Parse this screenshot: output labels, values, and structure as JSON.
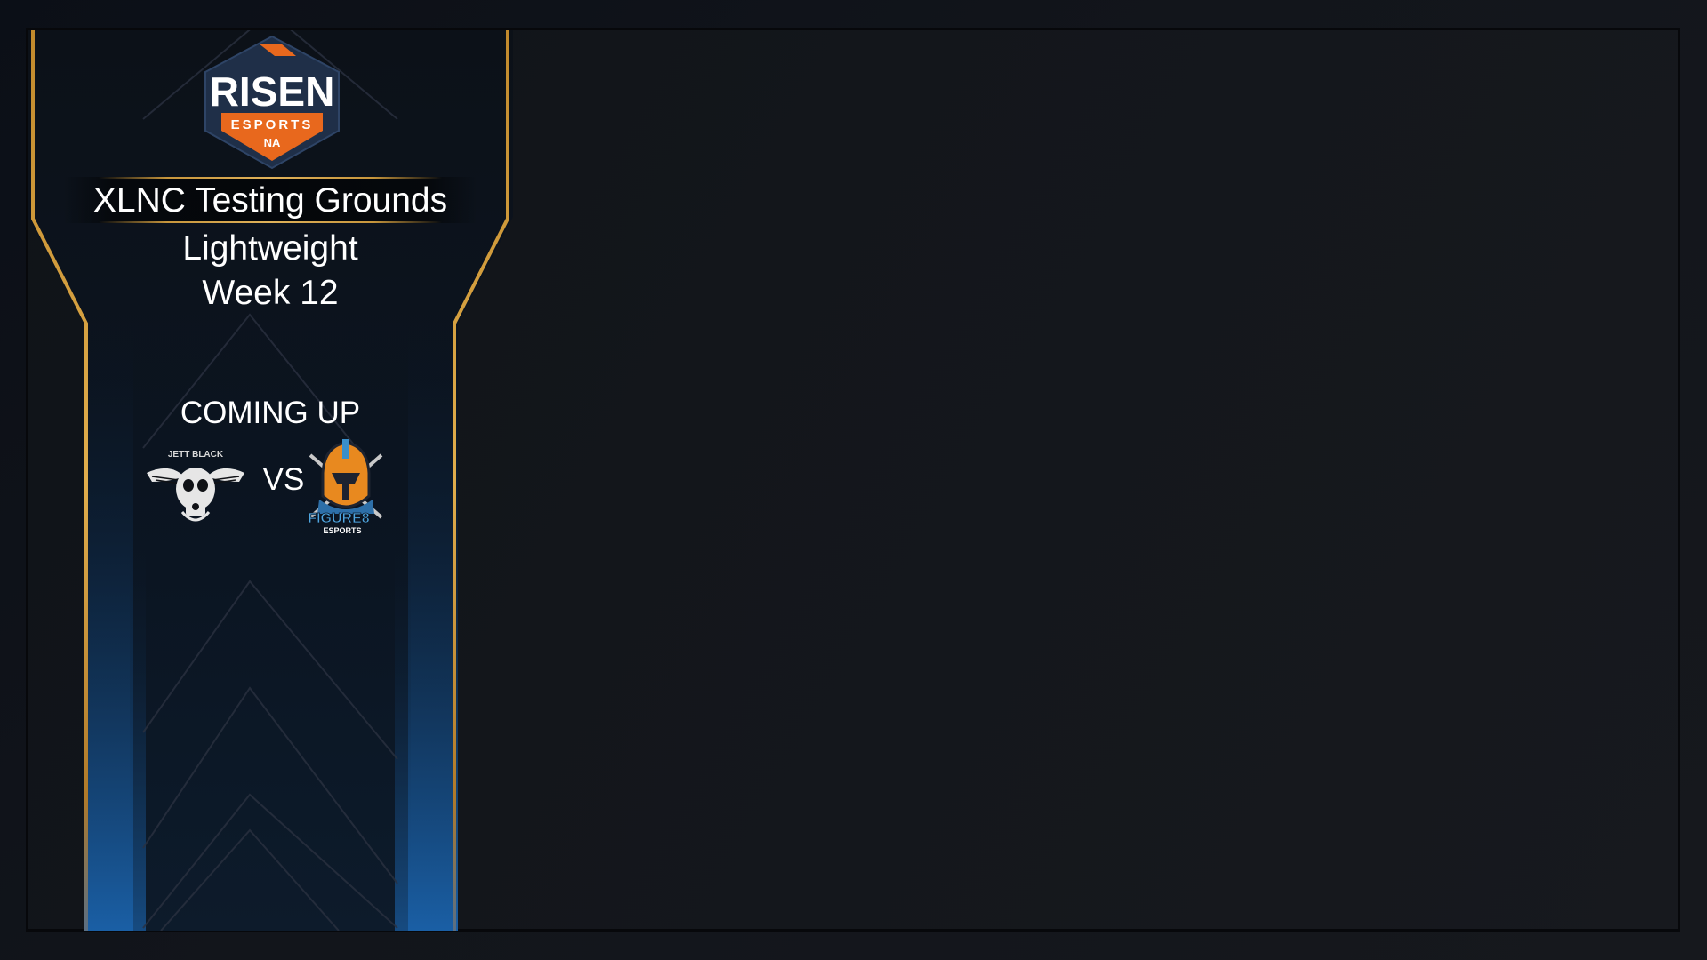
{
  "event": {
    "title": "XLNC Testing Grounds",
    "division": "Lightweight",
    "week": "Week 12"
  },
  "logo": {
    "brand": "RISEN",
    "subtitle": "ESPORTS",
    "region": "NA"
  },
  "matchup": {
    "heading": "COMING UP",
    "vs_label": "VS",
    "team_a": {
      "icon": "winged-skull-icon",
      "label": "JETT BLACK"
    },
    "team_b": {
      "icon": "spartan-helmet-icon",
      "label": "FIGURE8",
      "sublabel": "ESPORTS"
    }
  },
  "colors": {
    "accent_gold": "#d9a441",
    "accent_blue": "#1e6db5",
    "logo_orange": "#e8681d",
    "logo_navy": "#1f2f48"
  }
}
